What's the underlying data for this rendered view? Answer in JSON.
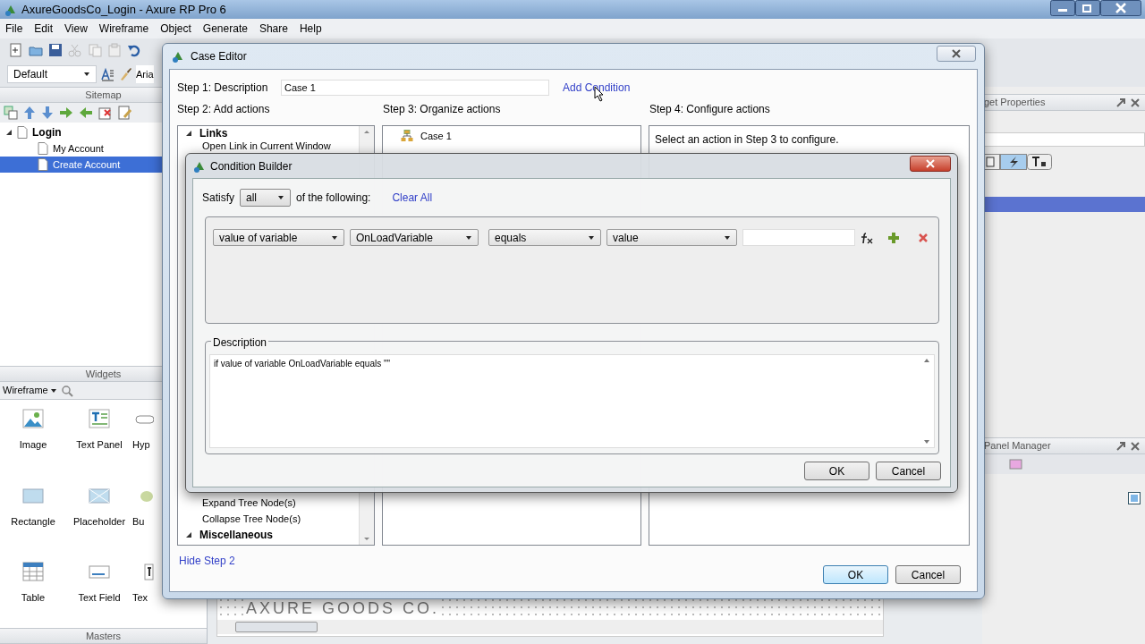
{
  "window": {
    "title": "AxureGoodsCo_Login - Axure RP Pro 6"
  },
  "menu": [
    "File",
    "Edit",
    "View",
    "Wireframe",
    "Object",
    "Generate",
    "Share",
    "Help"
  ],
  "toolbar": {
    "style": "Default",
    "font": "Aria"
  },
  "sitemap": {
    "title": "Sitemap",
    "pages": [
      {
        "label": "Login",
        "expanded": true,
        "selected": false,
        "children": [
          {
            "label": "My Account",
            "selected": false
          },
          {
            "label": "Create Account",
            "selected": true
          }
        ]
      }
    ]
  },
  "widgets": {
    "title": "Widgets",
    "library": "Wireframe",
    "items": [
      {
        "label": "Image",
        "kind": "image"
      },
      {
        "label": "Text Panel",
        "kind": "text_panel"
      },
      {
        "label": "Hyp",
        "kind": "hyperlink"
      },
      {
        "label": "Rectangle",
        "kind": "rectangle"
      },
      {
        "label": "Placeholder",
        "kind": "placeholder"
      },
      {
        "label": "Bu",
        "kind": "button"
      },
      {
        "label": "Table",
        "kind": "table"
      },
      {
        "label": "Text Field",
        "kind": "text_field"
      },
      {
        "label": "Tex",
        "kind": "text_area"
      }
    ]
  },
  "masters": {
    "title": "Masters"
  },
  "widget_properties": {
    "title": "get Properties"
  },
  "panel_manager": {
    "title": "Panel Manager"
  },
  "canvas": {
    "heading": "AXURE GOODS CO."
  },
  "case_editor": {
    "title": "Case Editor",
    "description_label": "Step 1: Description",
    "description": "Case 1",
    "add_condition": "Add Condition",
    "step2": "Step 2: Add actions",
    "step3": "Step 3: Organize actions",
    "step4": "Step 4: Configure actions",
    "actions": [
      {
        "label": "Links",
        "kind": "group"
      },
      {
        "label": "Open Link in Current Window",
        "kind": "action"
      },
      {
        "label": "Expand Tree Node(s)",
        "kind": "action"
      },
      {
        "label": "Collapse Tree Node(s)",
        "kind": "action"
      },
      {
        "label": "Miscellaneous",
        "kind": "group"
      }
    ],
    "cases": [
      "Case 1"
    ],
    "configure_hint": "Select an action in Step 3 to configure.",
    "hide_step": "Hide Step 2",
    "buttons": [
      "OK",
      "Cancel"
    ]
  },
  "condition_builder": {
    "title": "Condition Builder",
    "satisfy_label": "Satisfy",
    "satisfy": "all",
    "of_following": "of the following:",
    "clear_all": "Clear All",
    "conditions": [
      {
        "operand": "value of variable",
        "variable": "OnLoadVariable",
        "operator": "equals",
        "value_type": "value"
      }
    ],
    "description_title": "Description",
    "description": "if value of variable OnLoadVariable equals \"\"",
    "buttons": [
      "OK",
      "Cancel"
    ]
  }
}
